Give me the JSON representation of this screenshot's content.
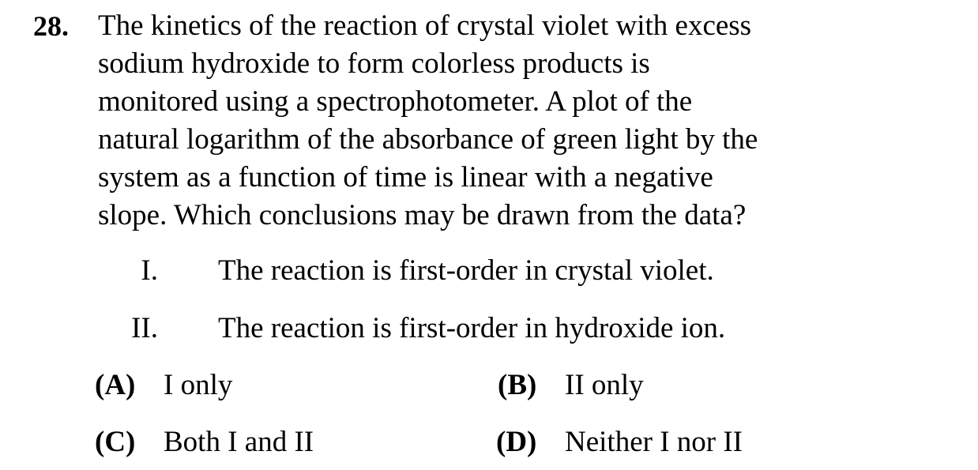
{
  "question": {
    "number": "28.",
    "stem_lines": [
      "The kinetics of the reaction of crystal violet with excess",
      "sodium hydroxide to form colorless products is",
      "monitored using a spectrophotometer.  A plot of the",
      "natural logarithm of the absorbance of green light by the",
      "system as a function of time is linear with a negative",
      "slope.  Which conclusions may be drawn from the data?"
    ],
    "statements": [
      {
        "numeral": "I.",
        "text": "The reaction is first-order in crystal violet."
      },
      {
        "numeral": "II.",
        "text": "The reaction is first-order in hydroxide ion."
      }
    ],
    "choices": [
      {
        "letter": "(A)",
        "text": "I only"
      },
      {
        "letter": "(B)",
        "text": "II only"
      },
      {
        "letter": "(C)",
        "text": "Both I and II"
      },
      {
        "letter": "(D)",
        "text": "Neither I nor II"
      }
    ]
  }
}
